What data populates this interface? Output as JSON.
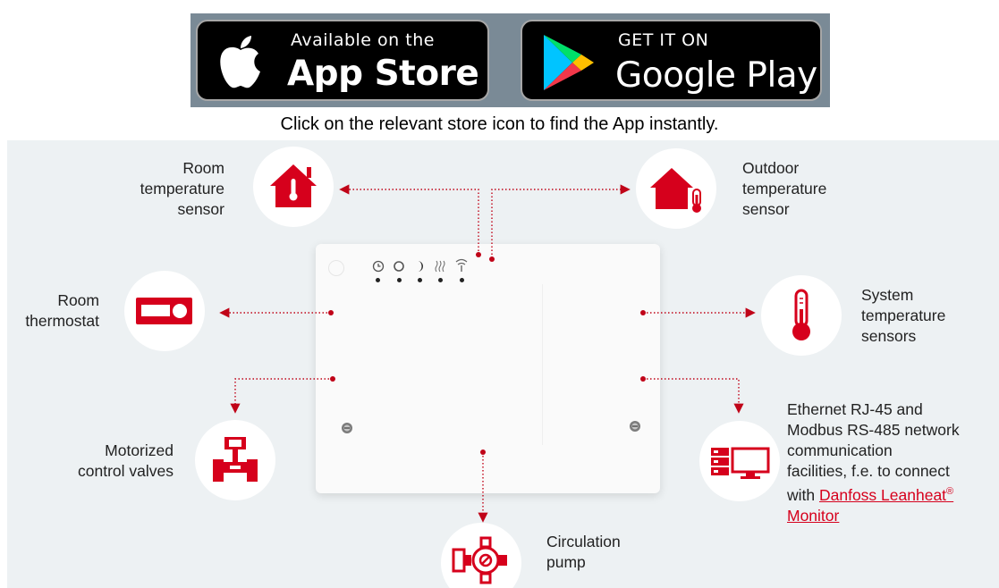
{
  "stores": {
    "app_store": {
      "line1": "Available on the",
      "line2": "App Store"
    },
    "google_play": {
      "line1": "GET IT ON",
      "line2": "Google Play"
    }
  },
  "caption": "Click on the relevant store icon to find the App instantly.",
  "colors": {
    "accent": "#d6001c",
    "diagram_bg": "#edf1f3",
    "store_bar": "#7a8a96"
  },
  "device": {
    "led_icons": [
      "clock-icon",
      "circle-icon",
      "moon-icon",
      "heating-icon",
      "antenna-icon"
    ]
  },
  "components": {
    "room_sensor": {
      "icon": "house-thermometer-icon",
      "lines": [
        "Room",
        "temperature",
        "sensor"
      ]
    },
    "outdoor_sensor": {
      "icon": "house-outdoor-thermometer-icon",
      "lines": [
        "Outdoor",
        "temperature",
        "sensor"
      ]
    },
    "room_thermostat": {
      "icon": "thermostat-icon",
      "lines": [
        "Room",
        "thermostat"
      ]
    },
    "system_sensors": {
      "icon": "thermometer-icon",
      "lines": [
        "System",
        "temperature",
        "sensors"
      ]
    },
    "valves": {
      "icon": "valve-icon",
      "lines": [
        "Motorized",
        "control valves"
      ]
    },
    "network": {
      "icon": "server-monitor-icon",
      "lines": [
        "Ethernet RJ-45 and",
        "Modbus RS-485 network",
        "communication",
        "facilities, f.e. to connect"
      ],
      "prefix": "with ",
      "link_text": "Danfoss Leanheat",
      "reg_mark": "®",
      "link_tail": "Monitor"
    },
    "pump": {
      "icon": "pump-icon",
      "lines": [
        "Circulation",
        "pump"
      ]
    }
  }
}
